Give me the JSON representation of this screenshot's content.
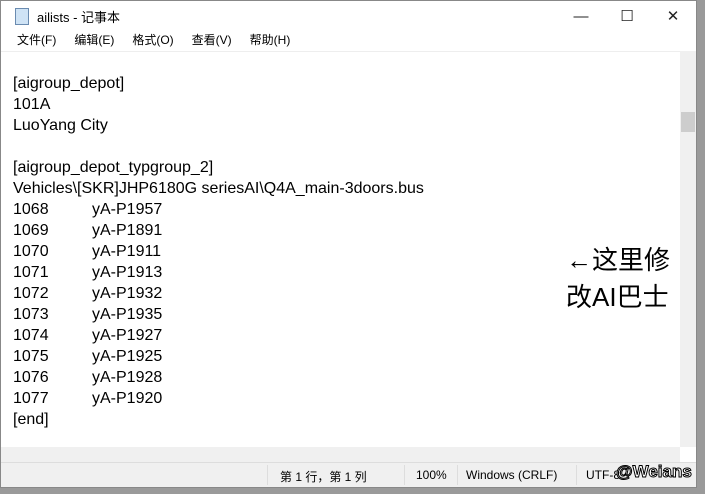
{
  "window": {
    "title": "ailists - 记事本",
    "minimize": "—",
    "maximize": "☐",
    "close": "✕"
  },
  "menu": [
    "文件(F)",
    "编辑(E)",
    "格式(O)",
    "查看(V)",
    "帮助(H)"
  ],
  "content": {
    "lines": [
      "",
      "[aigroup_depot]",
      "101A",
      "LuoYang City",
      "",
      "[aigroup_depot_typgroup_2]",
      "Vehicles\\[SKR]JHP6180G seriesAI\\Q4A_main-3doors.bus"
    ],
    "rows": [
      [
        "1068",
        "yA-P1957"
      ],
      [
        "1069",
        "yA-P1891"
      ],
      [
        "1070",
        "yA-P1911"
      ],
      [
        "1071",
        "yA-P1913"
      ],
      [
        "1072",
        "yA-P1932"
      ],
      [
        "1073",
        "yA-P1935"
      ],
      [
        "1074",
        "yA-P1927"
      ],
      [
        "1075",
        "yA-P1925"
      ],
      [
        "1076",
        "yA-P1928"
      ],
      [
        "1077",
        "yA-P1920"
      ]
    ],
    "end": "[end]"
  },
  "annotation": {
    "line1": "←这里修",
    "line2": "改AI巴士"
  },
  "status": {
    "position": "第 1 行，第 1 列",
    "zoom": "100%",
    "eol": "Windows (CRLF)",
    "encoding": "UTF-8"
  },
  "watermark": "@Weians"
}
